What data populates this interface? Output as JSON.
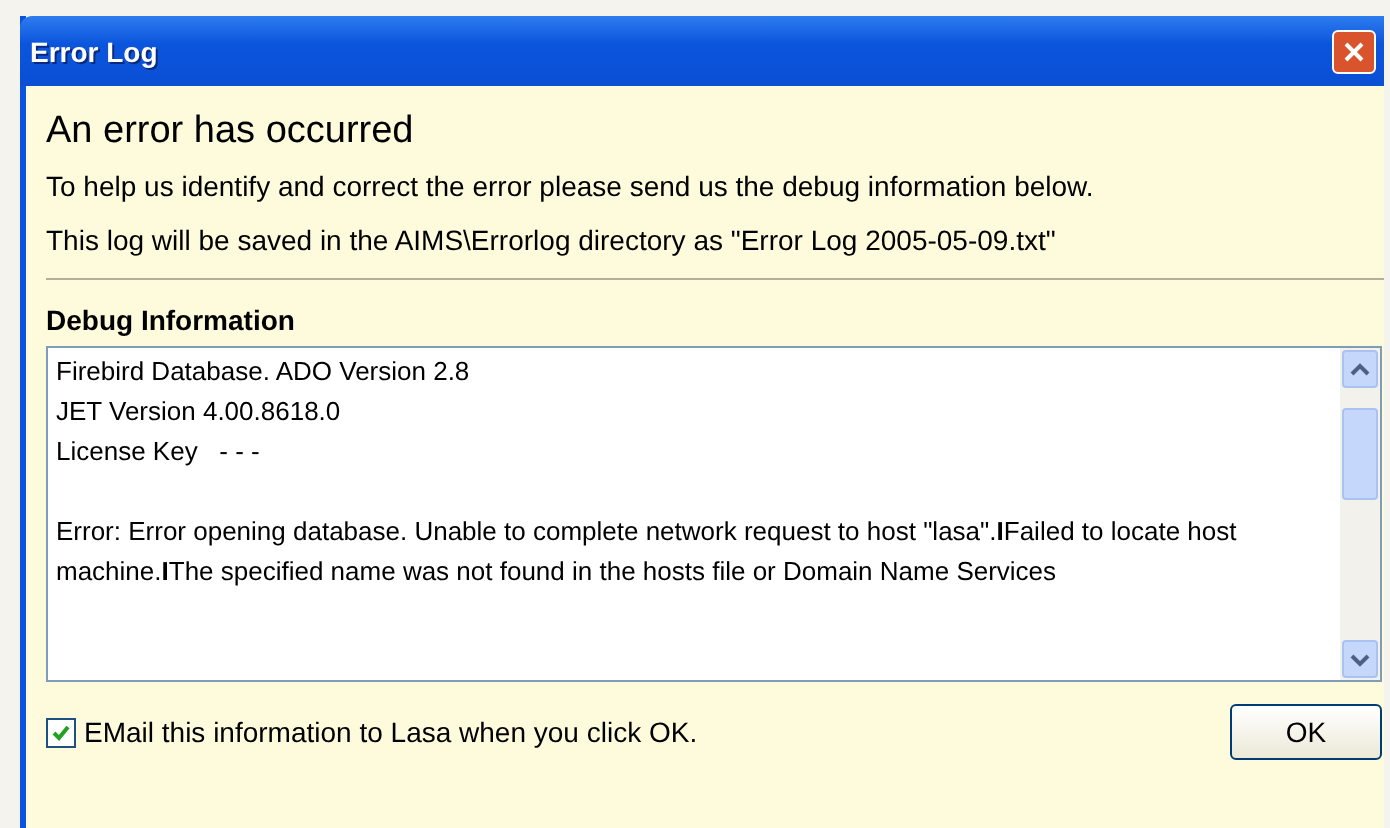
{
  "window": {
    "title": "Error Log"
  },
  "heading": "An error has occurred",
  "messages": [
    "To help us identify and correct the error please send us the debug information below.",
    "This log will be saved in the AIMS\\Errorlog directory as \"Error Log 2005-05-09.txt\""
  ],
  "debug": {
    "label": "Debug Information",
    "lines": [
      "Firebird Database. ADO Version 2.8",
      "JET Version 4.00.8618.0",
      "License Key   - - -"
    ],
    "error": "Error: Error opening database. Unable to complete network request to host \"lasa\".**I**Failed to locate host machine.**I**The specified name was not found in the hosts file or Domain Name Services"
  },
  "email_option": {
    "label": "EMail this information to Lasa when you click OK.",
    "checked": true
  },
  "buttons": [
    "OK"
  ]
}
